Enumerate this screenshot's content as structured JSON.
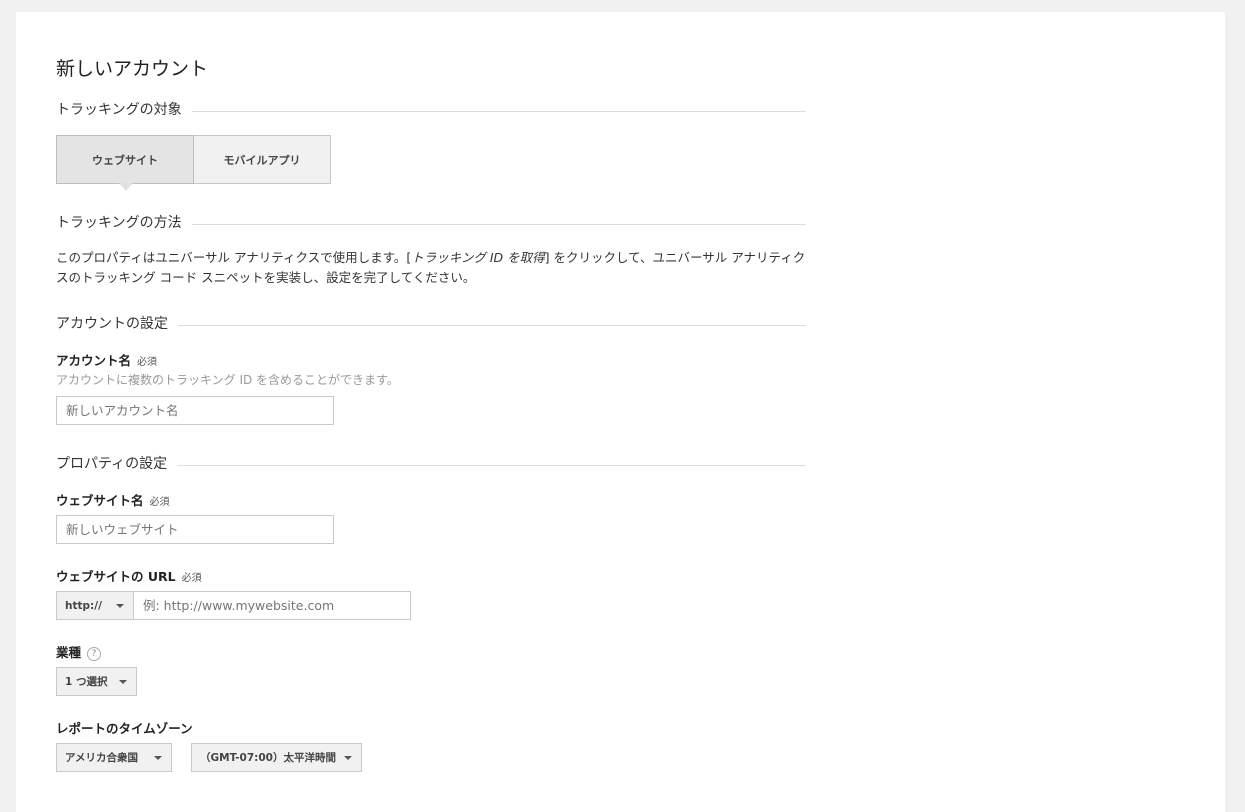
{
  "page": {
    "title": "新しいアカウント"
  },
  "sections": {
    "tracking_target": "トラッキングの対象",
    "tracking_method": "トラッキングの方法",
    "account_settings": "アカウントの設定",
    "property_settings": "プロパティの設定"
  },
  "target_toggle": {
    "website": "ウェブサイト",
    "mobile_app": "モバイルアプリ",
    "selected": "ウェブサイト"
  },
  "method_desc": {
    "part1": "このプロパティはユニバーサル アナリティクスで使用します。[",
    "link": "トラッキング ID を取得",
    "part2": "] をクリックして、ユニバーサル アナリティクスのトラッキング コード スニペットを実装し、設定を完了してください。"
  },
  "required_label": "必須",
  "account": {
    "label": "アカウント名",
    "hint": "アカウントに複数のトラッキング ID を含めることができます。",
    "placeholder": "新しいアカウント名",
    "value": ""
  },
  "website_name": {
    "label": "ウェブサイト名",
    "placeholder": "新しいウェブサイト",
    "value": ""
  },
  "website_url": {
    "label": "ウェブサイトの URL",
    "protocol": "http://",
    "placeholder": "例: http://www.mywebsite.com",
    "value": ""
  },
  "industry": {
    "label": "業種",
    "help_icon": "?",
    "selected": "1 つ選択"
  },
  "timezone": {
    "label": "レポートのタイムゾーン",
    "country": "アメリカ合衆国",
    "zone": "（GMT-07:00）太平洋時間"
  }
}
